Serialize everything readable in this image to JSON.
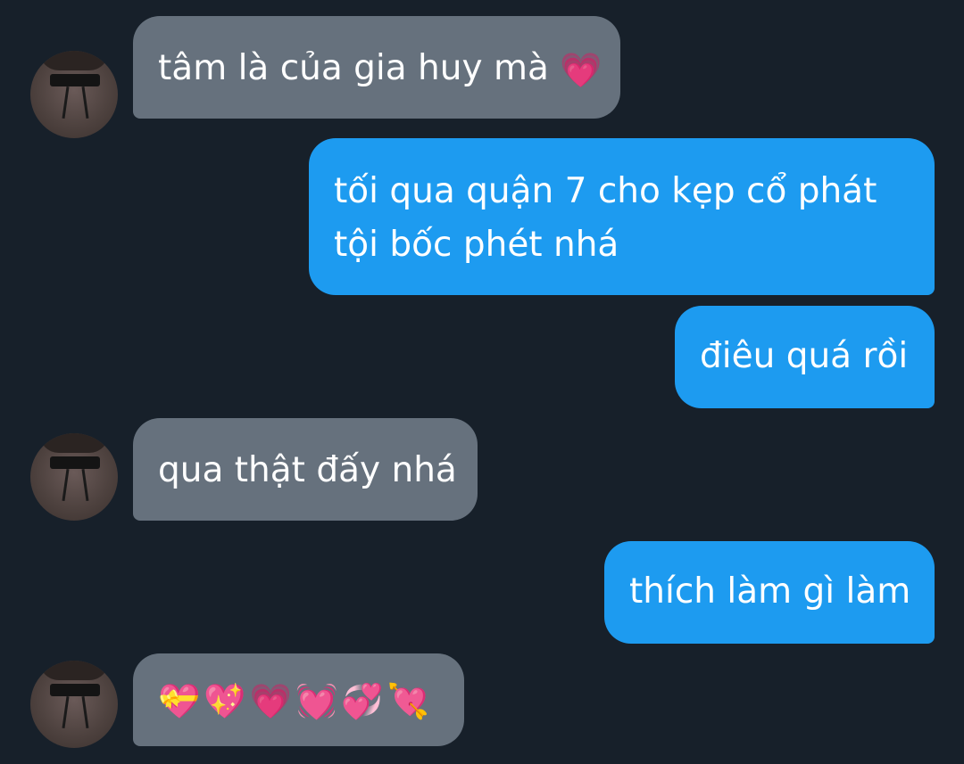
{
  "messages": [
    {
      "side": "received",
      "text": "tâm là của gia huy mà",
      "emoji": "💗"
    },
    {
      "side": "sent",
      "lines": [
        "tối qua quận 7 cho kẹp cổ phát",
        "tội bốc phét nhá"
      ]
    },
    {
      "side": "sent",
      "text": "điêu quá rồi"
    },
    {
      "side": "received",
      "text": "qua thật đấy nhá"
    },
    {
      "side": "sent",
      "text": "thích làm gì làm"
    },
    {
      "side": "received",
      "emoji_text": "💝💖💗💓💞💘"
    }
  ],
  "colors": {
    "background": "#17202a",
    "received_bubble": "#66717d",
    "sent_bubble": "#1d9bf0",
    "text": "#ffffff"
  },
  "icons": {
    "avatar": "profile-photo"
  }
}
